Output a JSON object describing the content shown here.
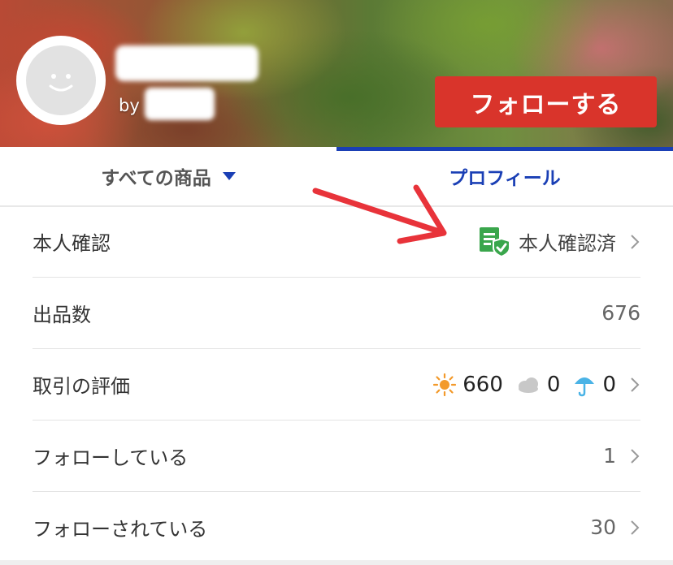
{
  "header": {
    "by_label": "by",
    "follow_label": "フォローする"
  },
  "tabs": [
    {
      "label": "すべての商品",
      "active": false
    },
    {
      "label": "プロフィール",
      "active": true
    }
  ],
  "rows": {
    "verification": {
      "label": "本人確認",
      "status": "本人確認済"
    },
    "listings": {
      "label": "出品数",
      "value": "676"
    },
    "rating": {
      "label": "取引の評価",
      "good": "660",
      "normal": "0",
      "bad": "0"
    },
    "following": {
      "label": "フォローしている",
      "value": "1"
    },
    "followers": {
      "label": "フォローされている",
      "value": "30"
    }
  },
  "colors": {
    "accent_red": "#d9342b",
    "active_tab_blue": "#1a3fb5",
    "verify_green": "#3aa64c",
    "sun_orange": "#f39a2b",
    "umbrella_blue": "#4ab3e6"
  },
  "icons": [
    "smiley-avatar-icon",
    "dropdown-triangle-icon",
    "annotation-arrow",
    "verified-document-icon",
    "chevron-right-icon",
    "sun-icon",
    "cloud-icon",
    "umbrella-icon"
  ]
}
